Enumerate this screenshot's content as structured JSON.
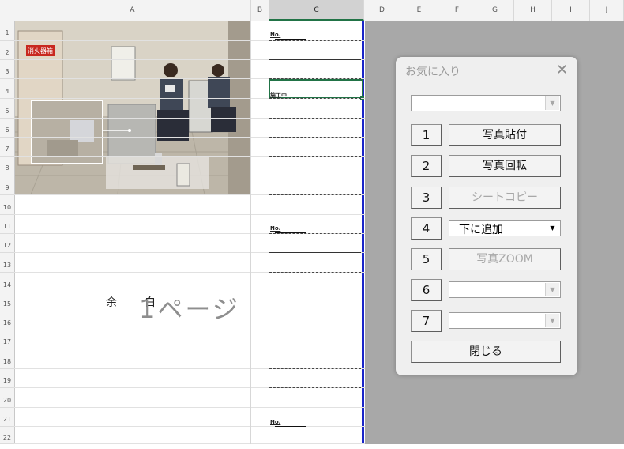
{
  "sheet": {
    "columns": [
      "A",
      "B",
      "C",
      "D",
      "E",
      "F",
      "G",
      "H",
      "I",
      "J"
    ],
    "rows": [
      "1",
      "2",
      "3",
      "4",
      "5",
      "6",
      "7",
      "8",
      "9",
      "10",
      "11",
      "12",
      "13",
      "14",
      "15",
      "16",
      "17",
      "18",
      "19",
      "20",
      "21",
      "22"
    ],
    "cells": {
      "no_label": "No.",
      "status_text": "施工中"
    },
    "blank_page": {
      "char1": "余",
      "char2": "白",
      "page_text": "1ページ"
    },
    "photo": {
      "fire_door_sign": "消火器箱"
    }
  },
  "dialog": {
    "title": "お気に入り",
    "top_combo_value": "",
    "rows": [
      {
        "number": "1",
        "kind": "button",
        "label": "写真貼付",
        "enabled": true
      },
      {
        "number": "2",
        "kind": "button",
        "label": "写真回転",
        "enabled": true
      },
      {
        "number": "3",
        "kind": "button",
        "label": "シートコピー",
        "enabled": false
      },
      {
        "number": "4",
        "kind": "combo",
        "label": "下に追加",
        "enabled": true
      },
      {
        "number": "5",
        "kind": "button",
        "label": "写真ZOOM",
        "enabled": false
      },
      {
        "number": "6",
        "kind": "combo",
        "label": "",
        "enabled": false
      },
      {
        "number": "7",
        "kind": "combo",
        "label": "",
        "enabled": false
      }
    ],
    "close_label": "閉じる"
  },
  "colors": {
    "selection_green": "#217346",
    "page_break_blue": "#1a25c8",
    "dialog_bg": "#efefef"
  }
}
